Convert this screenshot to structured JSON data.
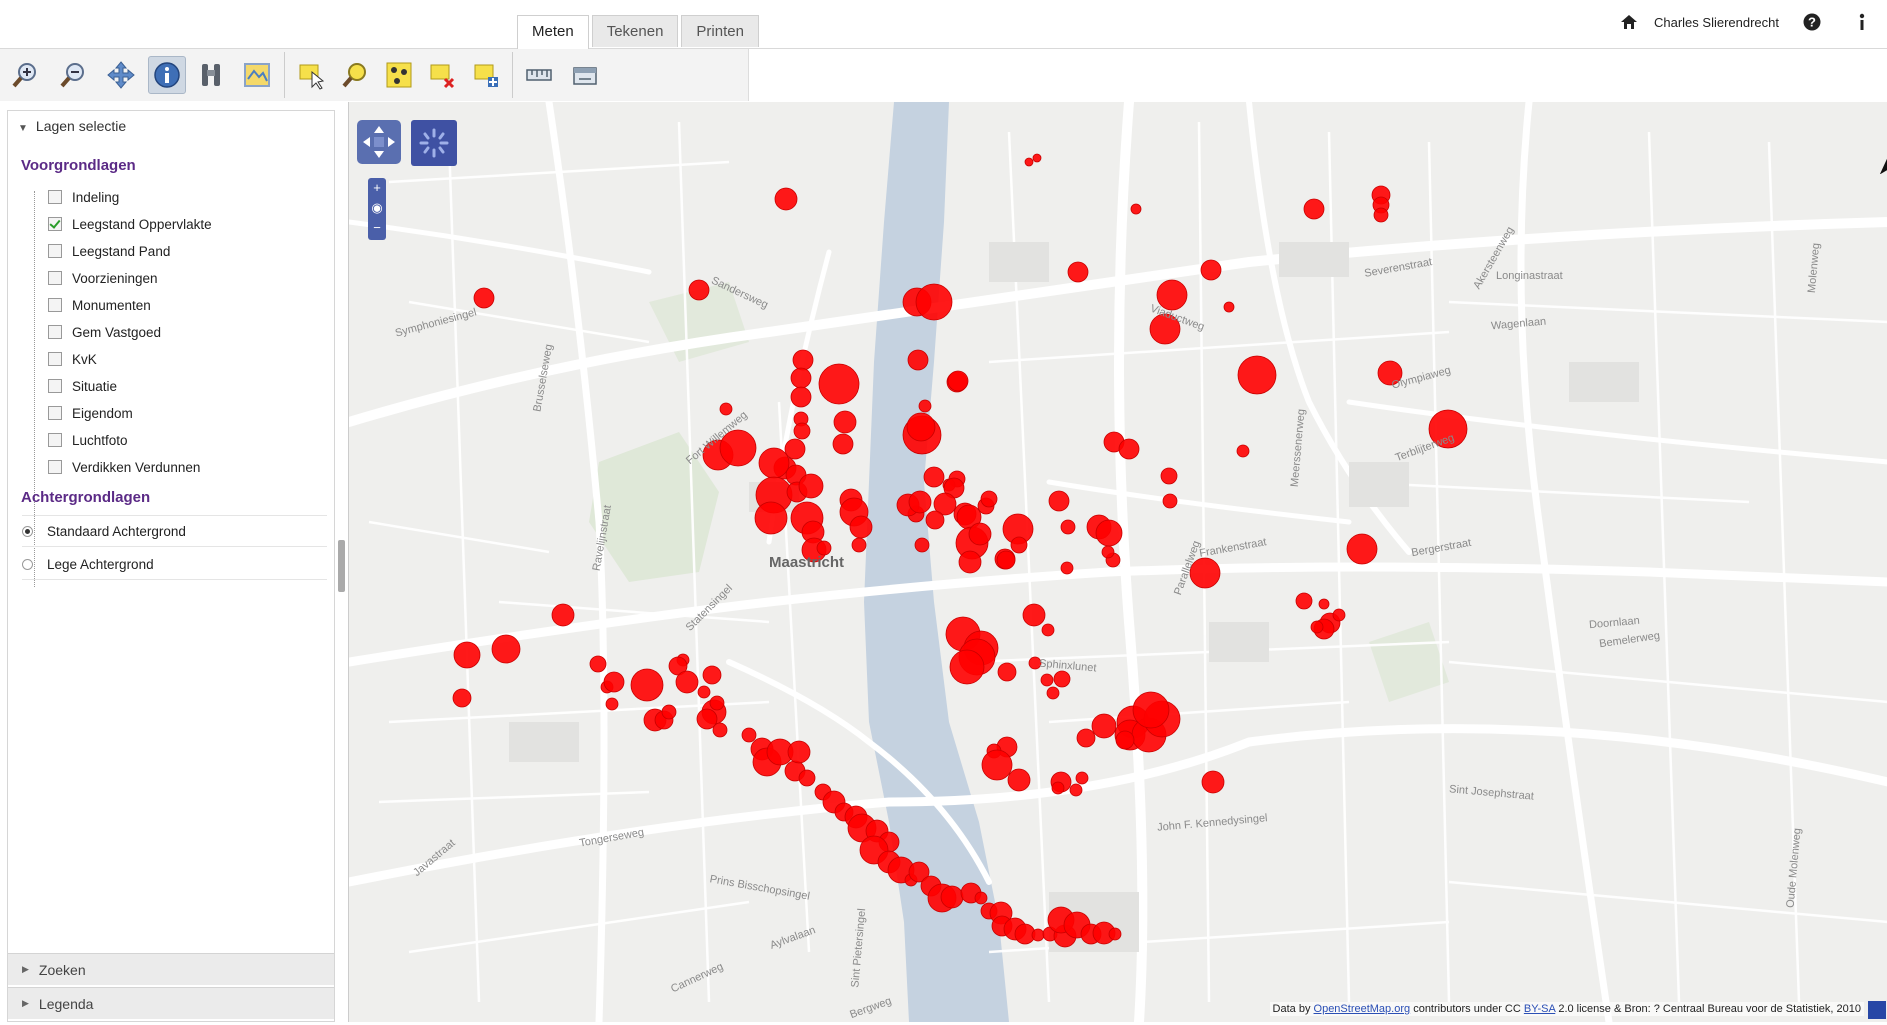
{
  "tabs": [
    {
      "label": "Meten",
      "active": true
    },
    {
      "label": "Tekenen",
      "active": false
    },
    {
      "label": "Printen",
      "active": false
    }
  ],
  "user": {
    "name": "Charles Slierendrecht"
  },
  "toolbar": {
    "tools": [
      "zoom-in-icon",
      "zoom-out-icon",
      "pan-icon",
      "info-icon",
      "binoculars-icon",
      "map-layer-icon",
      "select-arrow-icon",
      "select-search-icon",
      "select-points-icon",
      "clear-selection-icon",
      "add-selection-icon",
      "measure-ruler-icon",
      "measure-area-icon"
    ]
  },
  "sidebar": {
    "header": "Lagen selectie",
    "foreground_title": "Voorgrondlagen",
    "layers": [
      {
        "label": "Indeling",
        "checked": false
      },
      {
        "label": "Leegstand Oppervlakte",
        "checked": true
      },
      {
        "label": "Leegstand Pand",
        "checked": false
      },
      {
        "label": "Voorzieningen",
        "checked": false
      },
      {
        "label": "Monumenten",
        "checked": false
      },
      {
        "label": "Gem Vastgoed",
        "checked": false
      },
      {
        "label": "KvK",
        "checked": false
      },
      {
        "label": "Situatie",
        "checked": false
      },
      {
        "label": "Eigendom",
        "checked": false
      },
      {
        "label": "Luchtfoto",
        "checked": false
      },
      {
        "label": "Verdikken Verdunnen",
        "checked": false
      }
    ],
    "background_title": "Achtergrondlagen",
    "backgrounds": [
      {
        "label": "Standaard Achtergrond",
        "selected": true
      },
      {
        "label": "Lege Achtergrond",
        "selected": false
      }
    ],
    "accordions": [
      "Zoeken",
      "Legenda"
    ]
  },
  "map": {
    "city_label": "Maastricht",
    "street_labels": [
      "Sandersweg",
      "Symphoniesingel",
      "Brusselseweg",
      "Fort Willemweg",
      "Statensingel",
      "Ravelijnstraat",
      "Javastraat",
      "Tongerseweg",
      "Prins Bisschopsingel",
      "Aylvalaan",
      "Bergweg",
      "Sint Pietersingel",
      "Viaductweg",
      "Severenstraat",
      "Longinastraat",
      "Wagenlaan",
      "Olympiaweg",
      "Terblijterweg",
      "Frankenstraat",
      "Bergerstraat",
      "Doornlaan",
      "Bemelerweg",
      "Sphinxlunet",
      "John F. Kennedysingel",
      "Sint Josephstraat",
      "Akersteenweg",
      "Molenweg",
      "Oude Molenweg",
      "Meerssenerweg",
      "Parallelweg",
      "Cannerweg"
    ],
    "markers_shown": true,
    "marker_color": "#ff0000",
    "attribution": {
      "prefix": "Data by ",
      "link1": "OpenStreetMap.org",
      "mid": " contributors under CC ",
      "link2": "BY-SA",
      "suffix": " 2.0 license & Bron: ? Centraal Bureau voor de Statistiek, 2010"
    }
  }
}
